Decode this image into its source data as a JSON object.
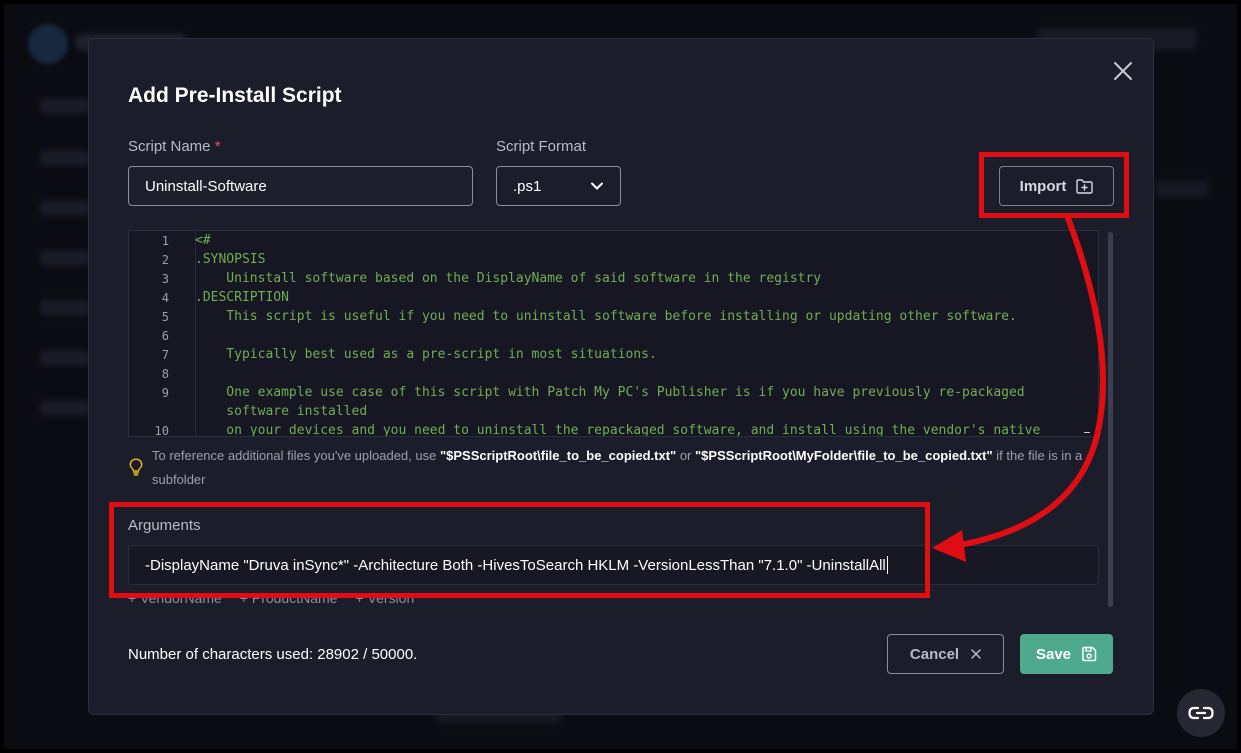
{
  "dialog": {
    "title": "Add Pre-Install Script",
    "script_name_label": "Script Name",
    "required_marker": "*",
    "script_name_value": "Uninstall-Software",
    "script_format_label": "Script Format",
    "script_format_value": ".ps1",
    "import_label": "Import",
    "code_lines": [
      {
        "num": "1",
        "text": "<#"
      },
      {
        "num": "2",
        "text": ".SYNOPSIS"
      },
      {
        "num": "3",
        "text": "    Uninstall software based on the DisplayName of said software in the registry"
      },
      {
        "num": "4",
        "text": ".DESCRIPTION"
      },
      {
        "num": "5",
        "text": "    This script is useful if you need to uninstall software before installing or updating other software."
      },
      {
        "num": "6",
        "text": ""
      },
      {
        "num": "7",
        "text": "    Typically best used as a pre-script in most situations."
      },
      {
        "num": "8",
        "text": ""
      },
      {
        "num": "9",
        "text": "    One example use case of this script with Patch My PC's Publisher is if you have previously re-packaged"
      },
      {
        "num": "",
        "text": "    software installed"
      },
      {
        "num": "10",
        "text": "    on your devices and you need to uninstall the repackaged software, and install using the vendor's native"
      }
    ],
    "hint": {
      "prefix": "To reference additional files you've uploaded, use ",
      "path1": "\"$PSScriptRoot\\file_to_be_copied.txt\"",
      "middle": " or ",
      "path2": "\"$PSScriptRoot\\MyFolder\\file_to_be_copied.txt\"",
      "suffix": " if the file is in a subfolder"
    },
    "arguments_label": "Arguments",
    "arguments_value": "-DisplayName \"Druva inSync*\" -Architecture Both -HivesToSearch HKLM -VersionLessThan \"7.1.0\" -UninstallAll",
    "tokens": [
      "+ VendorName",
      "+ ProductName",
      "+ Version"
    ],
    "char_count": "Number of characters used: 28902 / 50000.",
    "cancel_label": "Cancel",
    "save_label": "Save"
  },
  "icons": [
    "close-icon",
    "chevron-down-icon",
    "folder-plus-icon",
    "lightbulb-icon",
    "x-icon",
    "save-icon",
    "link-icon"
  ],
  "colors": {
    "dialog_bg": "#1c1d2a",
    "code_green": "#6fae55",
    "save_green": "#4eaa8c",
    "annotation_red": "#e00d12",
    "required_red": "#e25563"
  }
}
